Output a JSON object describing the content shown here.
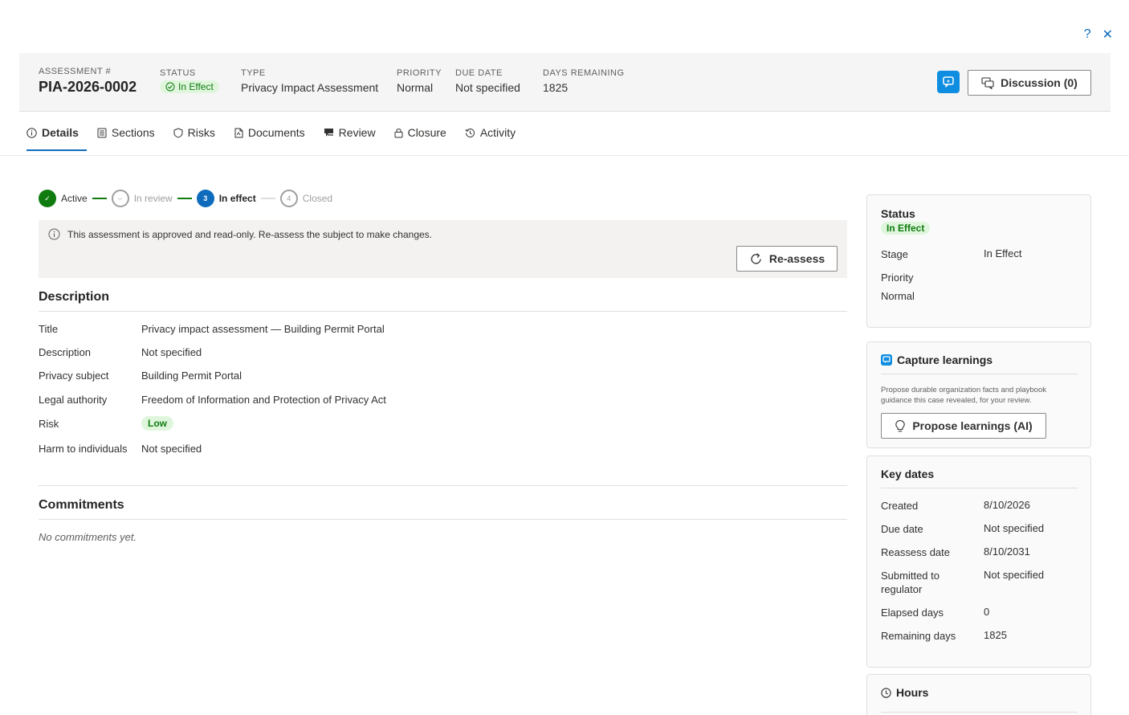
{
  "top": {
    "help": "?",
    "close": "✕"
  },
  "header": {
    "assessment_label": "ASSESSMENT #",
    "assessment_value": "PIA-2026-0002",
    "status_label": "STATUS",
    "status_value": "In Effect",
    "type_label": "TYPE",
    "type_value": "Privacy Impact Assessment",
    "priority_label": "PRIORITY",
    "priority_value": "Normal",
    "due_label": "DUE DATE",
    "due_value": "Not specified",
    "days_label": "DAYS REMAINING",
    "days_value": "1825",
    "discussion_label": "Discussion (0)"
  },
  "tabs": [
    {
      "label": "Details",
      "icon": "info-icon",
      "active": true
    },
    {
      "label": "Sections",
      "icon": "sections-icon"
    },
    {
      "label": "Risks",
      "icon": "shield-icon"
    },
    {
      "label": "Documents",
      "icon": "document-icon"
    },
    {
      "label": "Review",
      "icon": "review-icon"
    },
    {
      "label": "Closure",
      "icon": "lock-icon"
    },
    {
      "label": "Activity",
      "icon": "history-icon"
    }
  ],
  "stepper": [
    {
      "label": "Active",
      "state": "done",
      "marker": "✓"
    },
    {
      "label": "In review",
      "state": "skipped",
      "marker": "–"
    },
    {
      "label": "In effect",
      "state": "current",
      "marker": "3"
    },
    {
      "label": "Closed",
      "state": "todo",
      "marker": "4"
    }
  ],
  "notice": {
    "text": "This assessment is approved and read-only. Re-assess the subject to make changes.",
    "button": "Re-assess"
  },
  "description": {
    "title": "Description",
    "rows": [
      {
        "key": "Title",
        "value": "Privacy impact assessment — Building Permit Portal"
      },
      {
        "key": "Description",
        "value": "Not specified"
      },
      {
        "key": "Privacy subject",
        "value": "Building Permit Portal"
      },
      {
        "key": "Legal authority",
        "value": "Freedom of Information and Protection of Privacy Act"
      },
      {
        "key": "Risk",
        "value": "Low"
      },
      {
        "key": "Harm to individuals",
        "value": "Not specified"
      }
    ]
  },
  "commitments": {
    "title": "Commitments",
    "empty": "No commitments yet."
  },
  "status_card": {
    "title": "Status",
    "badge": "In Effect",
    "stage_label": "Stage",
    "stage_value": "In Effect",
    "priority_label": "Priority",
    "priority_value": "Normal"
  },
  "learnings_card": {
    "title": "Capture learnings",
    "body": "Propose durable organization facts and playbook guidance this case revealed, for your review.",
    "button": "Propose learnings (AI)"
  },
  "dates_card": {
    "title": "Key dates",
    "rows": [
      {
        "key": "Created",
        "value": "8/10/2026"
      },
      {
        "key": "Due date",
        "value": "Not specified"
      },
      {
        "key": "Reassess date",
        "value": "8/10/2031"
      },
      {
        "key": "Submitted to regulator",
        "value": "Not specified"
      },
      {
        "key": "Elapsed days",
        "value": "0"
      },
      {
        "key": "Remaining days",
        "value": "1825"
      }
    ]
  },
  "hours_card": {
    "title": "Hours"
  },
  "colors": {
    "accent": "#0f6cbd",
    "success": "#107c10",
    "success_bg": "#dff6dd"
  }
}
